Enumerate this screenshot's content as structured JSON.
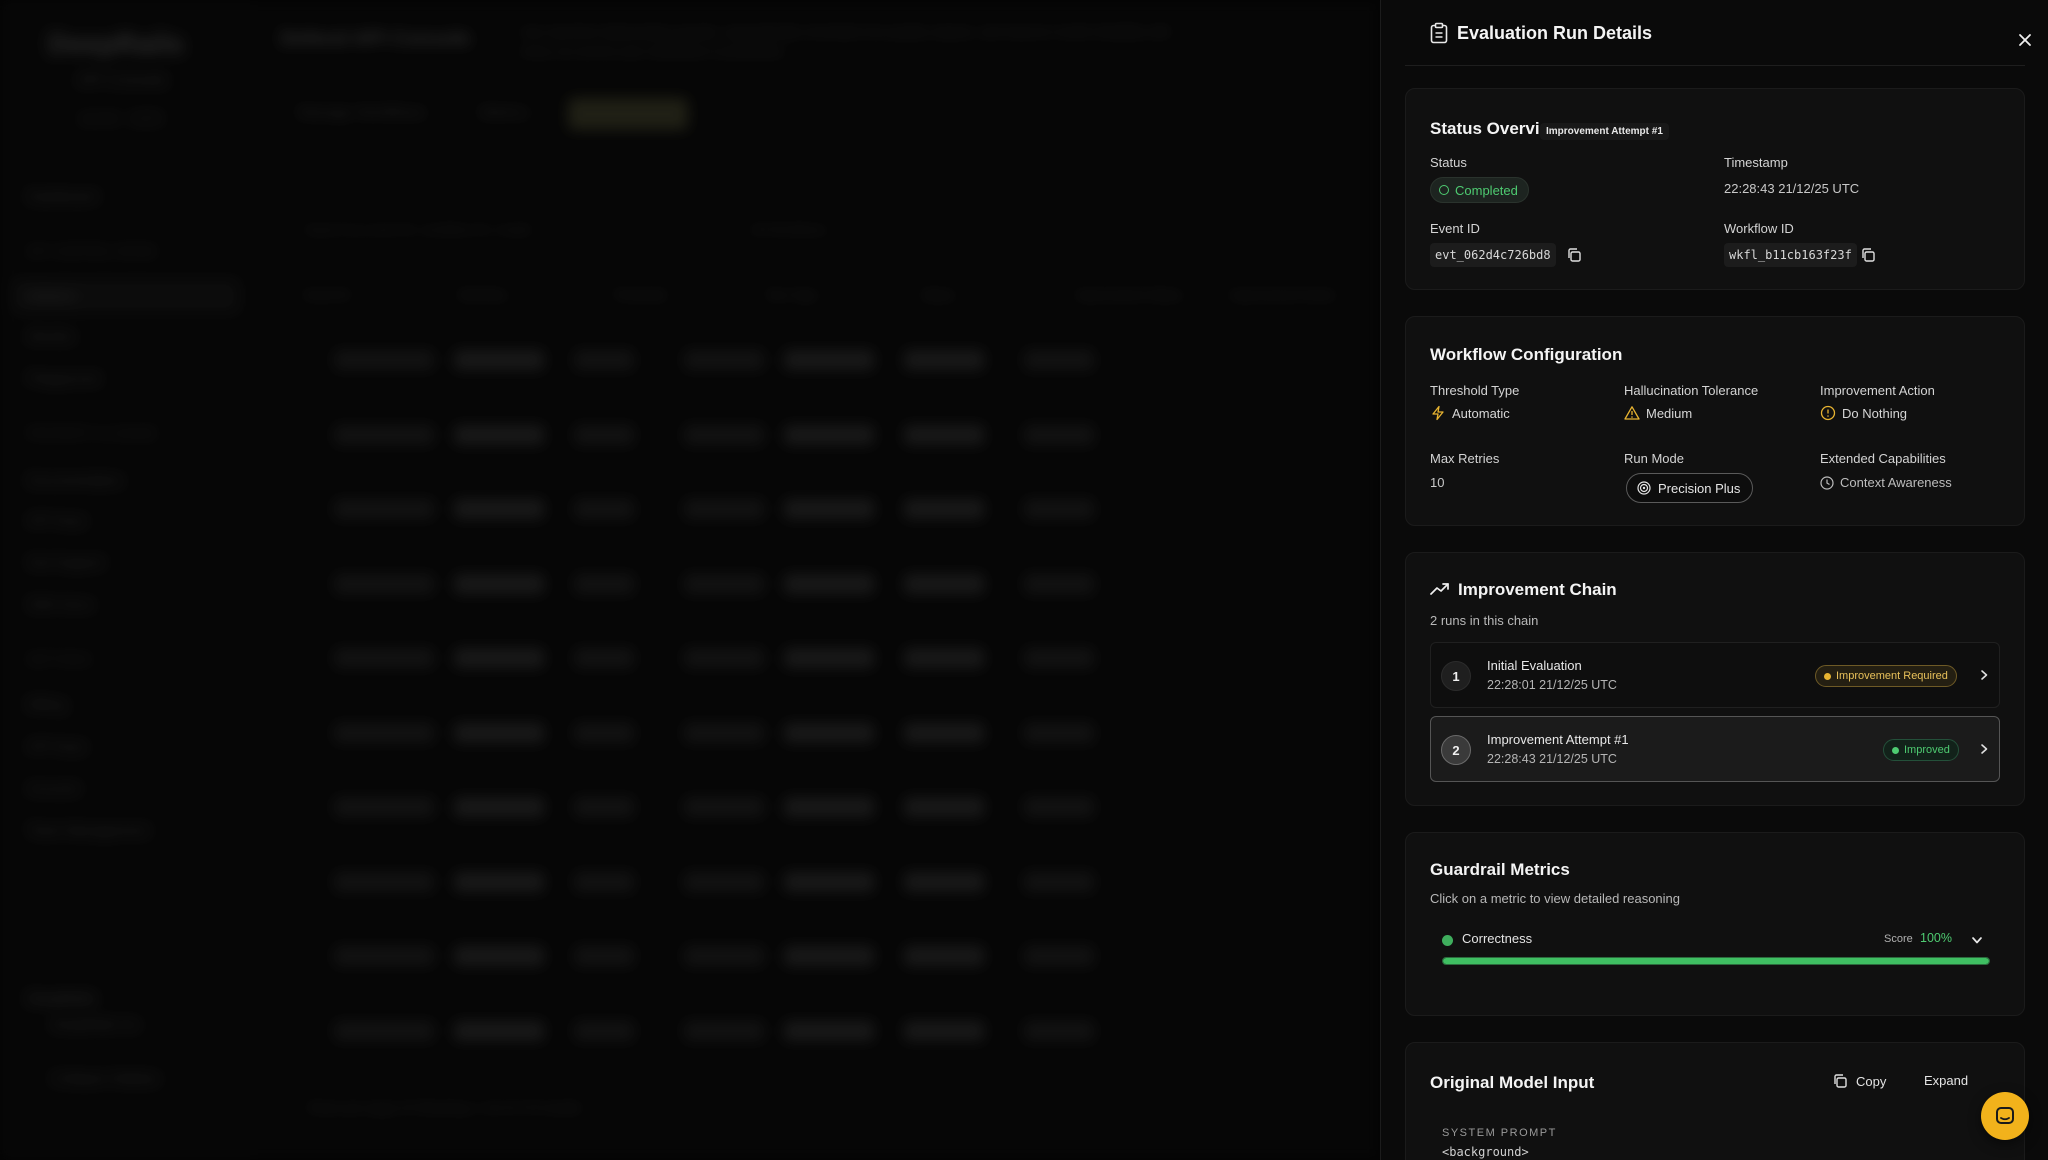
{
  "background": {
    "logo": "DeepRails",
    "logo_sub": "API Console",
    "logo_sub2": "v1.0.0 · 2025",
    "sidebar": {
      "top_item": "Dashboard",
      "section1": "API CONTROL ROOM",
      "items1": [
        "Defend",
        "Monitor",
        "Playground"
      ],
      "section2": "PROPERTY & USAGE",
      "items2": [
        "Documentation",
        "API Keys",
        "Get Support",
        "SDK Docs"
      ],
      "section3": "SETTINGS",
      "items3": [
        "Billing",
        "API Keys",
        "Account",
        "Team Management"
      ],
      "org": "DeepRails",
      "org_sub": "DeepRails Inc",
      "collapse": "Collapse Sidebar"
    },
    "title": "Defend API Console",
    "description": "Use real-time hallucination guards, automatically remediate low-quality outputs, and improve model reliability with every run across your workflows in production.",
    "tabs": [
      "Manage Workflows",
      "Metrics",
      "Data"
    ],
    "search_placeholder": "Search by event ID, workflow ID, model",
    "filter_label": "All Workflows",
    "table_headers": [
      "Event ID",
      "Workflow",
      "Threshold",
      "Run Type",
      "Status",
      "Improvement Status",
      "Improvement Action"
    ],
    "footer": "Rows per page   10        Showing 1–10 of 173 results"
  },
  "panel": {
    "title": "Evaluation Run Details",
    "status_overview": {
      "title": "Status Overview",
      "attempt_badge": "Improvement Attempt #1",
      "status_label": "Status",
      "status_value": "Completed",
      "timestamp_label": "Timestamp",
      "timestamp_value": "22:28:43 21/12/25 UTC",
      "event_id_label": "Event ID",
      "event_id_value": "evt_062d4c726bd8",
      "workflow_id_label": "Workflow ID",
      "workflow_id_value": "wkfl_b11cb163f23f"
    },
    "workflow_config": {
      "title": "Workflow Configuration",
      "threshold_type_label": "Threshold Type",
      "threshold_type_value": "Automatic",
      "hallucination_label": "Hallucination Tolerance",
      "hallucination_value": "Medium",
      "improvement_action_label": "Improvement Action",
      "improvement_action_value": "Do Nothing",
      "max_retries_label": "Max Retries",
      "max_retries_value": "10",
      "run_mode_label": "Run Mode",
      "run_mode_value": "Precision Plus",
      "extended_label": "Extended Capabilities",
      "extended_value": "Context Awareness"
    },
    "improvement_chain": {
      "title": "Improvement Chain",
      "subtitle": "2 runs in this chain",
      "runs": [
        {
          "num": "1",
          "title": "Initial Evaluation",
          "time": "22:28:01 21/12/25 UTC",
          "badge": "Improvement Required",
          "badge_kind": "warning",
          "selected": false
        },
        {
          "num": "2",
          "title": "Improvement Attempt #1",
          "time": "22:28:43 21/12/25 UTC",
          "badge": "Improved",
          "badge_kind": "success",
          "selected": true
        }
      ]
    },
    "guardrail_metrics": {
      "title": "Guardrail Metrics",
      "subtitle": "Click on a metric to view detailed reasoning",
      "metrics": [
        {
          "name": "Correctness",
          "score_label": "Score",
          "score": "100%",
          "fraction": 1.0
        }
      ]
    },
    "original_input": {
      "title": "Original Model Input",
      "copy_label": "Copy",
      "expand_label": "Expand",
      "system_prompt_label": "SYSTEM PROMPT",
      "system_prompt_text": "<background>"
    }
  },
  "colors": {
    "success": "#4ecb71",
    "warning": "#e8b431",
    "fab": "#f2b21b"
  }
}
